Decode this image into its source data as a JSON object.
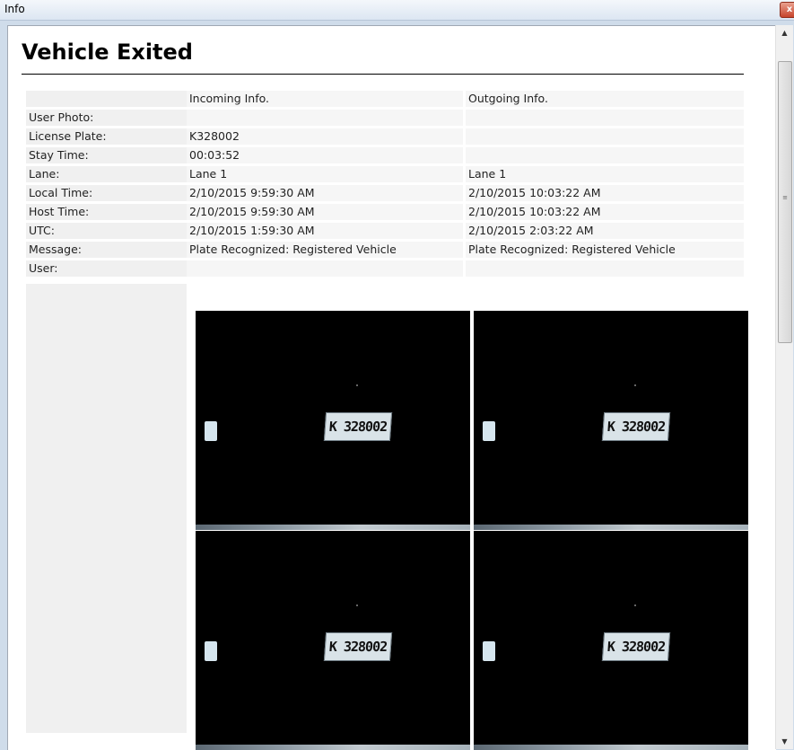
{
  "window": {
    "title": "Info",
    "close_glyph": "x"
  },
  "page": {
    "heading": "Vehicle Exited"
  },
  "table": {
    "header": [
      "",
      "Incoming Info.",
      "Outgoing Info."
    ],
    "rows": [
      {
        "label": "User Photo:",
        "incoming": "",
        "outgoing": ""
      },
      {
        "label": "License Plate:",
        "incoming": "K328002",
        "outgoing": ""
      },
      {
        "label": "Stay Time:",
        "incoming": "00:03:52",
        "outgoing": ""
      },
      {
        "label": "Lane:",
        "incoming": "Lane 1",
        "outgoing": "Lane 1"
      },
      {
        "label": "Local Time:",
        "incoming": "2/10/2015 9:59:30 AM",
        "outgoing": "2/10/2015 10:03:22 AM"
      },
      {
        "label": "Host Time:",
        "incoming": "2/10/2015 9:59:30 AM",
        "outgoing": "2/10/2015 10:03:22 AM"
      },
      {
        "label": "UTC:",
        "incoming": "2/10/2015 1:59:30 AM",
        "outgoing": "2/10/2015 2:03:22 AM"
      },
      {
        "label": "Message:",
        "incoming": "Plate Recognized: Registered Vehicle",
        "outgoing": "Plate Recognized: Registered Vehicle"
      },
      {
        "label": "User:",
        "incoming": "",
        "outgoing": ""
      }
    ]
  },
  "photos": {
    "plate_text": "K 328002",
    "incoming_label": "incoming-plate-images",
    "outgoing_label": "outgoing-plate-images"
  },
  "icons": {
    "close": "close-icon",
    "scroll_up": "scroll-up-arrow-icon",
    "scroll_down": "scroll-down-arrow-icon"
  }
}
